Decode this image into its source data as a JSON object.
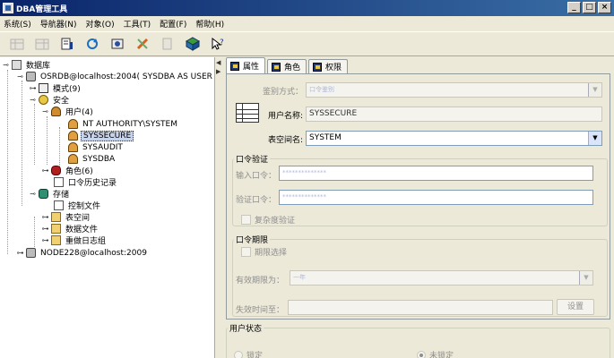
{
  "window": {
    "title": "DBA管理工具",
    "min": "_",
    "max": "□",
    "close": "×"
  },
  "menu": [
    "系统(S)",
    "导航器(N)",
    "对象(O)",
    "工具(T)",
    "配置(F)",
    "帮助(H)"
  ],
  "toolbar_icons": [
    "table-icon",
    "table-icon",
    "sql-icon",
    "refresh-icon",
    "schema-icon",
    "tools-icon",
    "copy-icon",
    "package-icon",
    "help-icon"
  ],
  "tree": {
    "root": "数据库",
    "server1": "OSRDB@localhost:2004( SYSDBA AS USER )",
    "schema": "模式(9)",
    "security": "安全",
    "users": "用户(4)",
    "user1": "NT AUTHORITY\\SYSTEM",
    "user2": "SYSSECURE",
    "user3": "SYSAUDIT",
    "user4": "SYSDBA",
    "roles": "角色(6)",
    "pwd_history": "口令历史记录",
    "storage": "存储",
    "control_files": "控制文件",
    "tablespaces": "表空间",
    "data_files": "数据文件",
    "redo_logs": "重做日志组",
    "server2": "NODE228@localhost:2009"
  },
  "tabs": [
    "属性",
    "角色",
    "权限"
  ],
  "form": {
    "auth_label": "鉴别方式：",
    "auth_value": "口令鉴别",
    "username_label": "用户名称:",
    "username_value": "SYSSECURE",
    "tablespace_label": "表空间名:",
    "tablespace_value": "SYSTEM",
    "pwd_group": "口令验证",
    "pwd_label": "输入口令：",
    "pwd_value": "**************",
    "pwd_confirm_label": "验证口令：",
    "pwd_confirm_value": "**************",
    "complex_check": "复杂度验证",
    "expiry_group": "口令期限",
    "expiry_check": "期限选择",
    "valid_period_label": "有效期限为：",
    "valid_period_value": "一年",
    "expire_time_label": "失效时间至：",
    "settings_button": "设置"
  },
  "status": {
    "group": "用户状态",
    "locked": "锁定",
    "unlocked": "未锁定"
  }
}
